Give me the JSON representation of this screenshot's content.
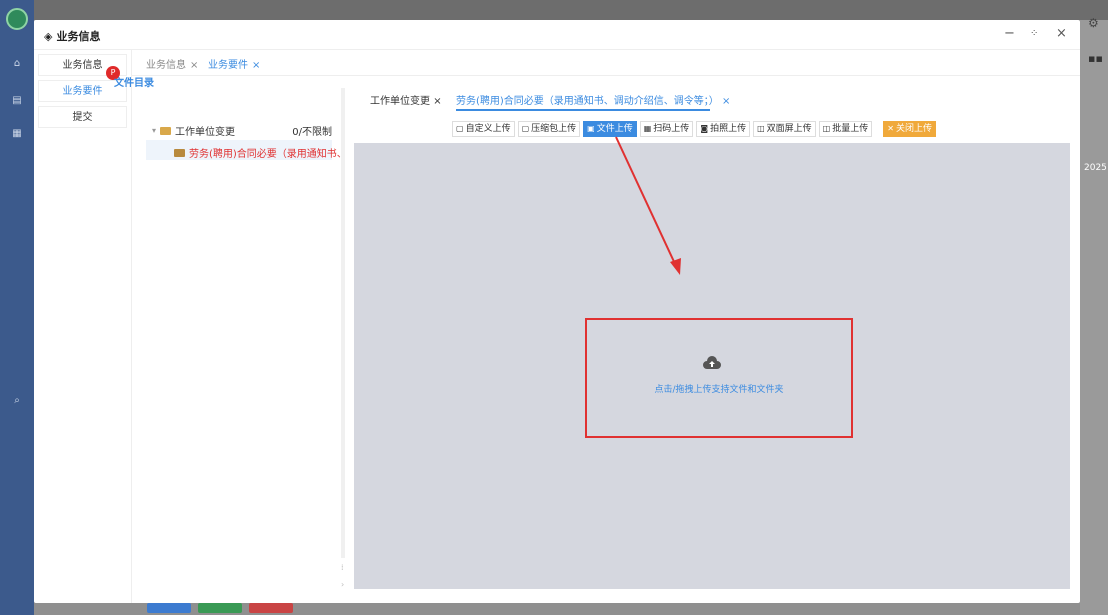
{
  "background": {
    "right_text": "2025"
  },
  "modal": {
    "title": "业务信息",
    "controls": {
      "minimize": "−",
      "expand": "⛶",
      "close": "×"
    }
  },
  "left_nav": {
    "items": [
      {
        "label": "业务信息"
      },
      {
        "label": "业务要件"
      },
      {
        "label": "提交"
      }
    ]
  },
  "top_tabs": [
    {
      "label": "业务信息",
      "close": "×"
    },
    {
      "label": "业务要件",
      "close": "×"
    }
  ],
  "directory": {
    "badge": "P",
    "title": "文件目录",
    "root": {
      "label": "工作单位变更",
      "limit": "0/不限制"
    },
    "child": {
      "label": "劳务(聘用)合同必要（录用通知书、"
    }
  },
  "doc_tabs": [
    {
      "label": "工作单位变更",
      "close": "×"
    },
    {
      "label": "劳务(聘用)合同必要（录用通知书、调动介绍信、调令等；）",
      "close": "×"
    }
  ],
  "toolbar": {
    "buttons": [
      {
        "icon": "custom-upload-icon",
        "label": "自定义上传"
      },
      {
        "icon": "zip-icon",
        "label": "压缩包上传"
      },
      {
        "icon": "file-icon",
        "label": "文件上传"
      },
      {
        "icon": "qrcode-icon",
        "label": "扫码上传"
      },
      {
        "icon": "camera-icon",
        "label": "拍照上传"
      },
      {
        "icon": "dual-screen-icon",
        "label": "双面屏上传"
      },
      {
        "icon": "batch-icon",
        "label": "批量上传"
      },
      {
        "icon": "close-icon",
        "label": "关闭上传"
      }
    ]
  },
  "upload": {
    "hint": "点击/拖拽上传支持文件和文件夹"
  },
  "colors": {
    "accent": "#3b8be0",
    "highlight": "#e03131",
    "close_button": "#f0a93b"
  }
}
